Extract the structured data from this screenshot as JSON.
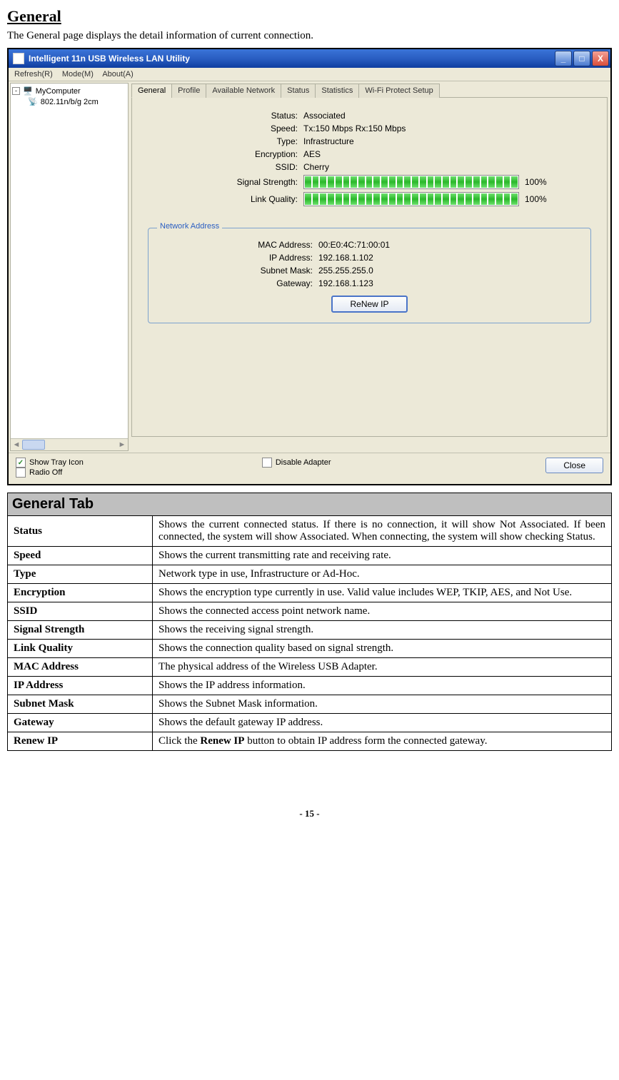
{
  "doc": {
    "heading": "General",
    "intro": "The General page displays the detail information of current connection.",
    "page_num": "- 15 -"
  },
  "window": {
    "title": "Intelligent 11n USB Wireless LAN Utility",
    "menu": {
      "refresh": "Refresh(R)",
      "mode": "Mode(M)",
      "about": "About(A)"
    },
    "tree": {
      "root": "MyComputer",
      "adapter": "802.11n/b/g 2cm"
    },
    "tabs": {
      "general": "General",
      "profile": "Profile",
      "available": "Available Network",
      "status": "Status",
      "statistics": "Statistics",
      "wps": "Wi-Fi Protect Setup"
    },
    "fields": {
      "status_l": "Status:",
      "status_v": "Associated",
      "speed_l": "Speed:",
      "speed_v": "Tx:150 Mbps Rx:150 Mbps",
      "type_l": "Type:",
      "type_v": "Infrastructure",
      "enc_l": "Encryption:",
      "enc_v": "AES",
      "ssid_l": "SSID:",
      "ssid_v": "Cherry",
      "sig_l": "Signal Strength:",
      "sig_pct": "100%",
      "lq_l": "Link Quality:",
      "lq_pct": "100%"
    },
    "group": {
      "title": "Network Address",
      "mac_l": "MAC Address:",
      "mac_v": "00:E0:4C:71:00:01",
      "ip_l": "IP Address:",
      "ip_v": "192.168.1.102",
      "sm_l": "Subnet Mask:",
      "sm_v": "255.255.255.0",
      "gw_l": "Gateway:",
      "gw_v": "192.168.1.123",
      "renew_btn": "ReNew IP"
    },
    "bottom": {
      "show_tray": "Show Tray Icon",
      "radio_off": "Radio Off",
      "disable": "Disable Adapter",
      "close": "Close"
    }
  },
  "table": {
    "header": "General Tab",
    "rows": [
      {
        "label": "Status",
        "desc": "Shows the current connected status. If there is no connection, it will show Not Associated. If been connected, the system will show Associated. When connecting, the system will show checking Status."
      },
      {
        "label": "Speed",
        "desc": "Shows the current transmitting rate and receiving rate."
      },
      {
        "label": "Type",
        "desc": "Network type in use, Infrastructure or Ad-Hoc."
      },
      {
        "label": "Encryption",
        "desc": "Shows the encryption type currently in use. Valid value includes WEP, TKIP, AES, and Not Use."
      },
      {
        "label": "SSID",
        "desc": "Shows the connected access point network name."
      },
      {
        "label": "Signal Strength",
        "desc": "Shows the receiving signal strength."
      },
      {
        "label": "Link Quality",
        "desc": "Shows the connection quality based on signal strength."
      },
      {
        "label": "MAC Address",
        "desc": "The physical address of the Wireless USB Adapter."
      },
      {
        "label": "IP Address",
        "desc": "Shows the IP address information."
      },
      {
        "label": "Subnet Mask",
        "desc": "Shows the Subnet Mask information."
      },
      {
        "label": "Gateway",
        "desc": "Shows the default gateway IP address."
      },
      {
        "label": "Renew IP",
        "desc_html": "Click the <b>Renew IP</b> button to obtain IP address form the connected gateway."
      }
    ]
  }
}
